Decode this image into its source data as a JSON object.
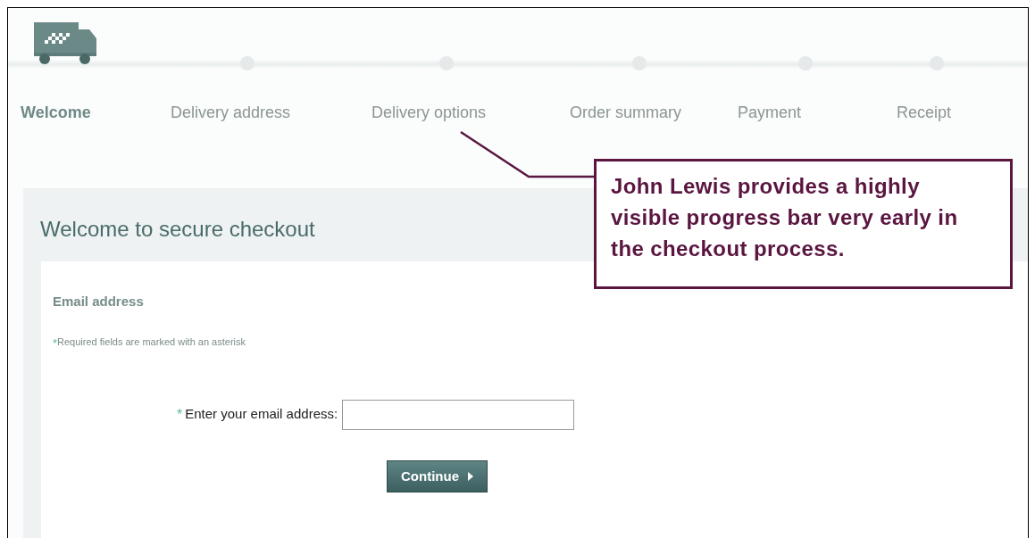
{
  "progress": {
    "steps": [
      {
        "label": "Welcome",
        "selected": true
      },
      {
        "label": "Delivery address",
        "selected": false
      },
      {
        "label": "Delivery options",
        "selected": false
      },
      {
        "label": "Order summary",
        "selected": false
      },
      {
        "label": "Payment",
        "selected": false
      },
      {
        "label": "Receipt",
        "selected": false
      }
    ]
  },
  "callout": {
    "text": "John Lewis provides a highly visible progress bar very early in the checkout process."
  },
  "page": {
    "title": "Welcome to secure checkout",
    "section": {
      "heading": "Email address",
      "required_mark": "*",
      "required_note": "Required fields are marked with an asterisk",
      "field": {
        "mark": "*",
        "label": "Enter your email address:"
      },
      "button": "Continue"
    }
  }
}
